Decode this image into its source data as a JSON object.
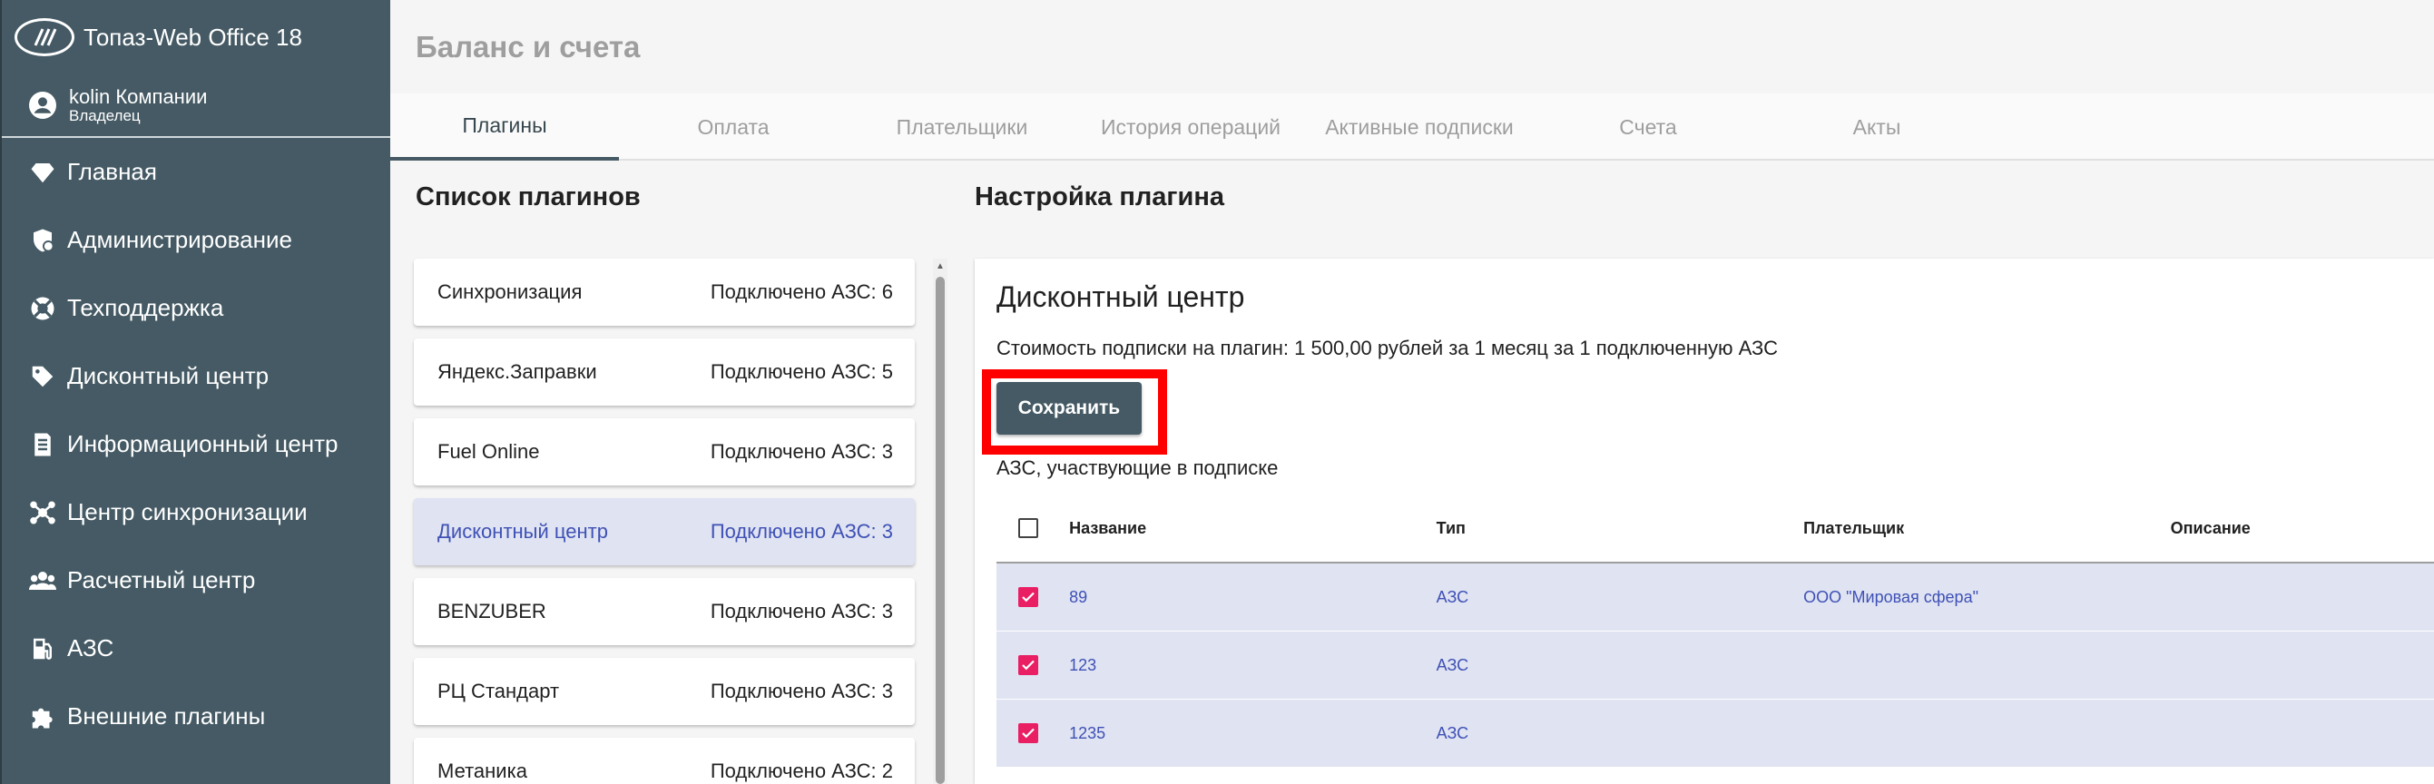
{
  "app": {
    "title": "Топаз-Web Office 18",
    "user_name": "kolin Компании",
    "user_role": "Владелец"
  },
  "sidebar": {
    "items": [
      {
        "label": "Главная",
        "icon": "diamond-icon"
      },
      {
        "label": "Администрирование",
        "icon": "shield-gear-icon"
      },
      {
        "label": "Техподдержка",
        "icon": "lifebuoy-icon"
      },
      {
        "label": "Дисконтный центр",
        "icon": "tag-icon"
      },
      {
        "label": "Информационный центр",
        "icon": "document-icon"
      },
      {
        "label": "Центр синхронизации",
        "icon": "network-icon"
      },
      {
        "label": "Расчетный центр",
        "icon": "users-icon"
      },
      {
        "label": "АЗС",
        "icon": "fuel-pump-icon"
      },
      {
        "label": "Внешние плагины",
        "icon": "puzzle-icon"
      }
    ]
  },
  "page": {
    "title": "Баланс и счета"
  },
  "tabs": [
    {
      "label": "Плагины",
      "active": true
    },
    {
      "label": "Оплата",
      "active": false
    },
    {
      "label": "Плательщики",
      "active": false
    },
    {
      "label": "История операций",
      "active": false
    },
    {
      "label": "Активные подписки",
      "active": false
    },
    {
      "label": "Счета",
      "active": false
    },
    {
      "label": "Акты",
      "active": false
    }
  ],
  "plugins": {
    "title": "Список плагинов",
    "items": [
      {
        "name": "Синхронизация",
        "count": "Подключено АЗС: 6",
        "selected": false
      },
      {
        "name": "Яндекс.Заправки",
        "count": "Подключено АЗС: 5",
        "selected": false
      },
      {
        "name": "Fuel Online",
        "count": "Подключено АЗС: 3",
        "selected": false
      },
      {
        "name": "Дисконтный центр",
        "count": "Подключено АЗС: 3",
        "selected": true
      },
      {
        "name": "BENZUBER",
        "count": "Подключено АЗС: 3",
        "selected": false
      },
      {
        "name": "РЦ Стандарт",
        "count": "Подключено АЗС: 3",
        "selected": false
      },
      {
        "name": "Метаника",
        "count": "Подключено АЗС: 2",
        "selected": false
      }
    ]
  },
  "settings": {
    "title": "Настройка плагина",
    "plugin_name": "Дисконтный центр",
    "price_text": "Стоимость подписки на плагин: 1 500,00 рублей за 1 месяц за 1 подключенную АЗС",
    "save_label": "Сохранить",
    "azs_label": "АЗС, участвующие в подписке",
    "table": {
      "headers": {
        "name": "Название",
        "type": "Тип",
        "payer": "Плательщик",
        "description": "Описание"
      },
      "rows": [
        {
          "name": "89",
          "type": "АЗС",
          "payer": "ООО \"Мировая сфера\"",
          "description": "",
          "checked": true
        },
        {
          "name": "123",
          "type": "АЗС",
          "payer": "",
          "description": "",
          "checked": true
        },
        {
          "name": "1235",
          "type": "АЗС",
          "payer": "",
          "description": "",
          "checked": true
        }
      ]
    }
  },
  "colors": {
    "sidebar_bg": "#455a64",
    "accent": "#3f51b5",
    "selection_bg": "#dfe3f2",
    "checkbox_checked": "#e91e63",
    "highlight_box": "#ff0000"
  }
}
